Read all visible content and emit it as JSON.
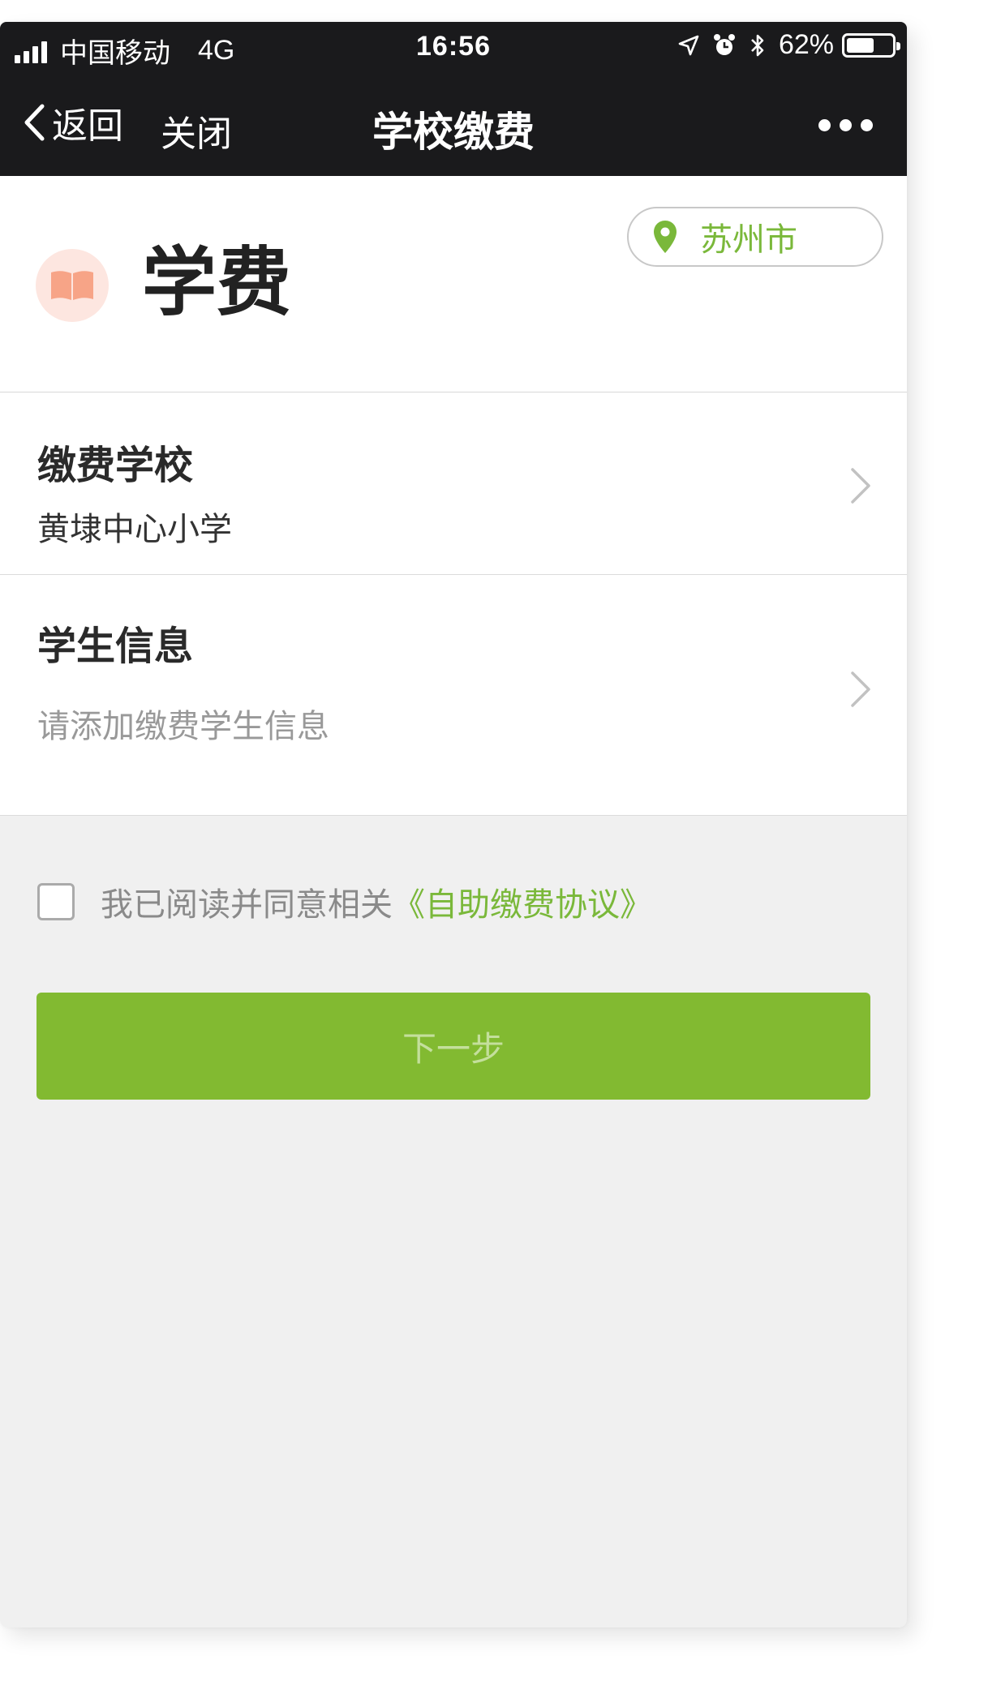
{
  "status_bar": {
    "carrier": "中国移动",
    "network": "4G",
    "time": "16:56",
    "battery": "62%",
    "battery_level": 0.62,
    "icons": [
      "signal-icon",
      "location-arrow-icon",
      "alarm-icon",
      "bluetooth-icon",
      "battery-icon"
    ]
  },
  "nav": {
    "back_label": "返回",
    "close_label": "关闭",
    "title": "学校缴费",
    "more_icon": "more-dots-icon"
  },
  "header": {
    "title": "学费",
    "icon": "book-icon",
    "city": "苏州市",
    "city_icon": "location-pin-icon"
  },
  "school_row": {
    "title": "缴费学校",
    "value": "黄埭中心小学"
  },
  "student_row": {
    "title": "学生信息",
    "placeholder": "请添加缴费学生信息"
  },
  "agreement": {
    "checked": false,
    "text": "我已阅读并同意相关",
    "link": "《自助缴费协议》"
  },
  "next_button": {
    "label": "下一步",
    "enabled": false
  },
  "colors": {
    "accent": "#82ba31",
    "link": "#7ab83a",
    "nav_bg": "#1a1a1c",
    "page_bg": "#f0f0f0",
    "icon_bg": "#fde6e0",
    "icon_fg": "#f7a487"
  }
}
